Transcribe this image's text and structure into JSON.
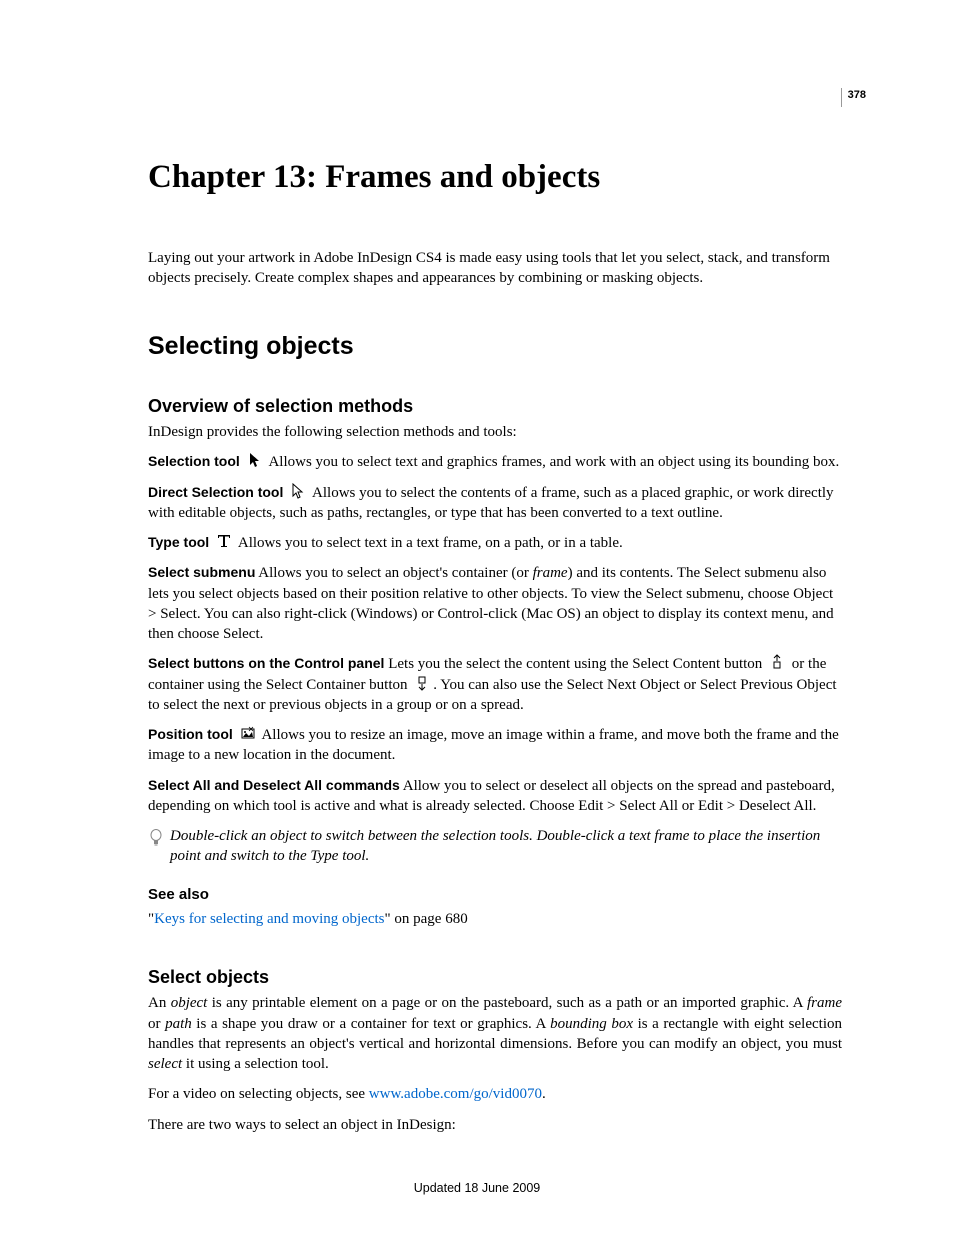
{
  "page_number": "378",
  "chapter_title": "Chapter 13: Frames and objects",
  "intro": "Laying out your artwork in Adobe InDesign CS4 is made easy using tools that let you select, stack, and transform objects precisely. Create complex shapes and appearances by combining or masking objects.",
  "h2": "Selecting objects",
  "h3_overview": "Overview of selection methods",
  "overview_intro": "InDesign provides the following selection methods and tools:",
  "selection_tool_term": "Selection tool",
  "selection_tool_desc": "  Allows you to select text and graphics frames, and work with an object using its bounding box.",
  "direct_tool_term": "Direct Selection tool",
  "direct_tool_desc": "  Allows you to select the contents of a frame, such as a placed graphic, or work directly with editable objects, such as paths, rectangles, or type that has been converted to a text outline.",
  "type_tool_term": "Type tool",
  "type_tool_desc": "  Allows you to select text in a text frame, on a path, or in a table.",
  "select_submenu_term": "Select submenu",
  "select_submenu_pre": "  Allows you to select an object's container (or ",
  "select_submenu_italic": "frame",
  "select_submenu_post": ") and its contents. The Select submenu also lets you select objects based on their position relative to other objects. To view the Select submenu, choose Object > Select. You can also right-click (Windows) or Control-click (Mac OS) an object to display its context menu, and then choose Select.",
  "select_buttons_term": "Select buttons on the Control panel",
  "select_buttons_desc1": "  Lets you the select the content using the Select Content button ",
  "select_buttons_desc2": " or the container using the Select Container button ",
  "select_buttons_desc3": ". You can also use the Select Next Object or Select Previous Object to select the next or previous objects in a group or on a spread.",
  "position_tool_term": "Position tool",
  "position_tool_desc": "  Allows you to resize an image, move an image within a frame, and move both the frame and the image to a new location in the document.",
  "select_all_term": "Select All and Deselect All commands",
  "select_all_desc": "  Allow you to select or deselect all objects on the spread and pasteboard, depending on which tool is active and what is already selected. Choose Edit > Select All or Edit > Deselect All.",
  "tip": "Double-click an object to switch between the selection tools. Double-click a text frame to place the insertion point and switch to the Type tool.",
  "see_also": "See also",
  "see_also_link": "Keys for selecting and moving objects",
  "see_also_suffix": "\" on page 680",
  "see_also_prefix": "\"",
  "h3_select": "Select objects",
  "select_p1_a": "An ",
  "select_p1_obj": "object",
  "select_p1_b": " is any printable element on a page or on the pasteboard, such as a path or an imported graphic. A ",
  "select_p1_frame": "frame",
  "select_p1_c": " or ",
  "select_p1_path": "path",
  "select_p1_d": " is a shape you draw or a container for text or graphics. A ",
  "select_p1_bbox": "bounding box",
  "select_p1_e": " is a rectangle with eight selection handles that represents an object's vertical and horizontal dimensions. Before you can modify an object, you must ",
  "select_p1_sel": "select",
  "select_p1_f": " it using a selection tool.",
  "video_pre": "For a video on selecting objects, see ",
  "video_link": "www.adobe.com/go/vid0070",
  "video_post": ".",
  "ways": "There are two ways to select an object in InDesign:",
  "footer": "Updated 18 June 2009"
}
